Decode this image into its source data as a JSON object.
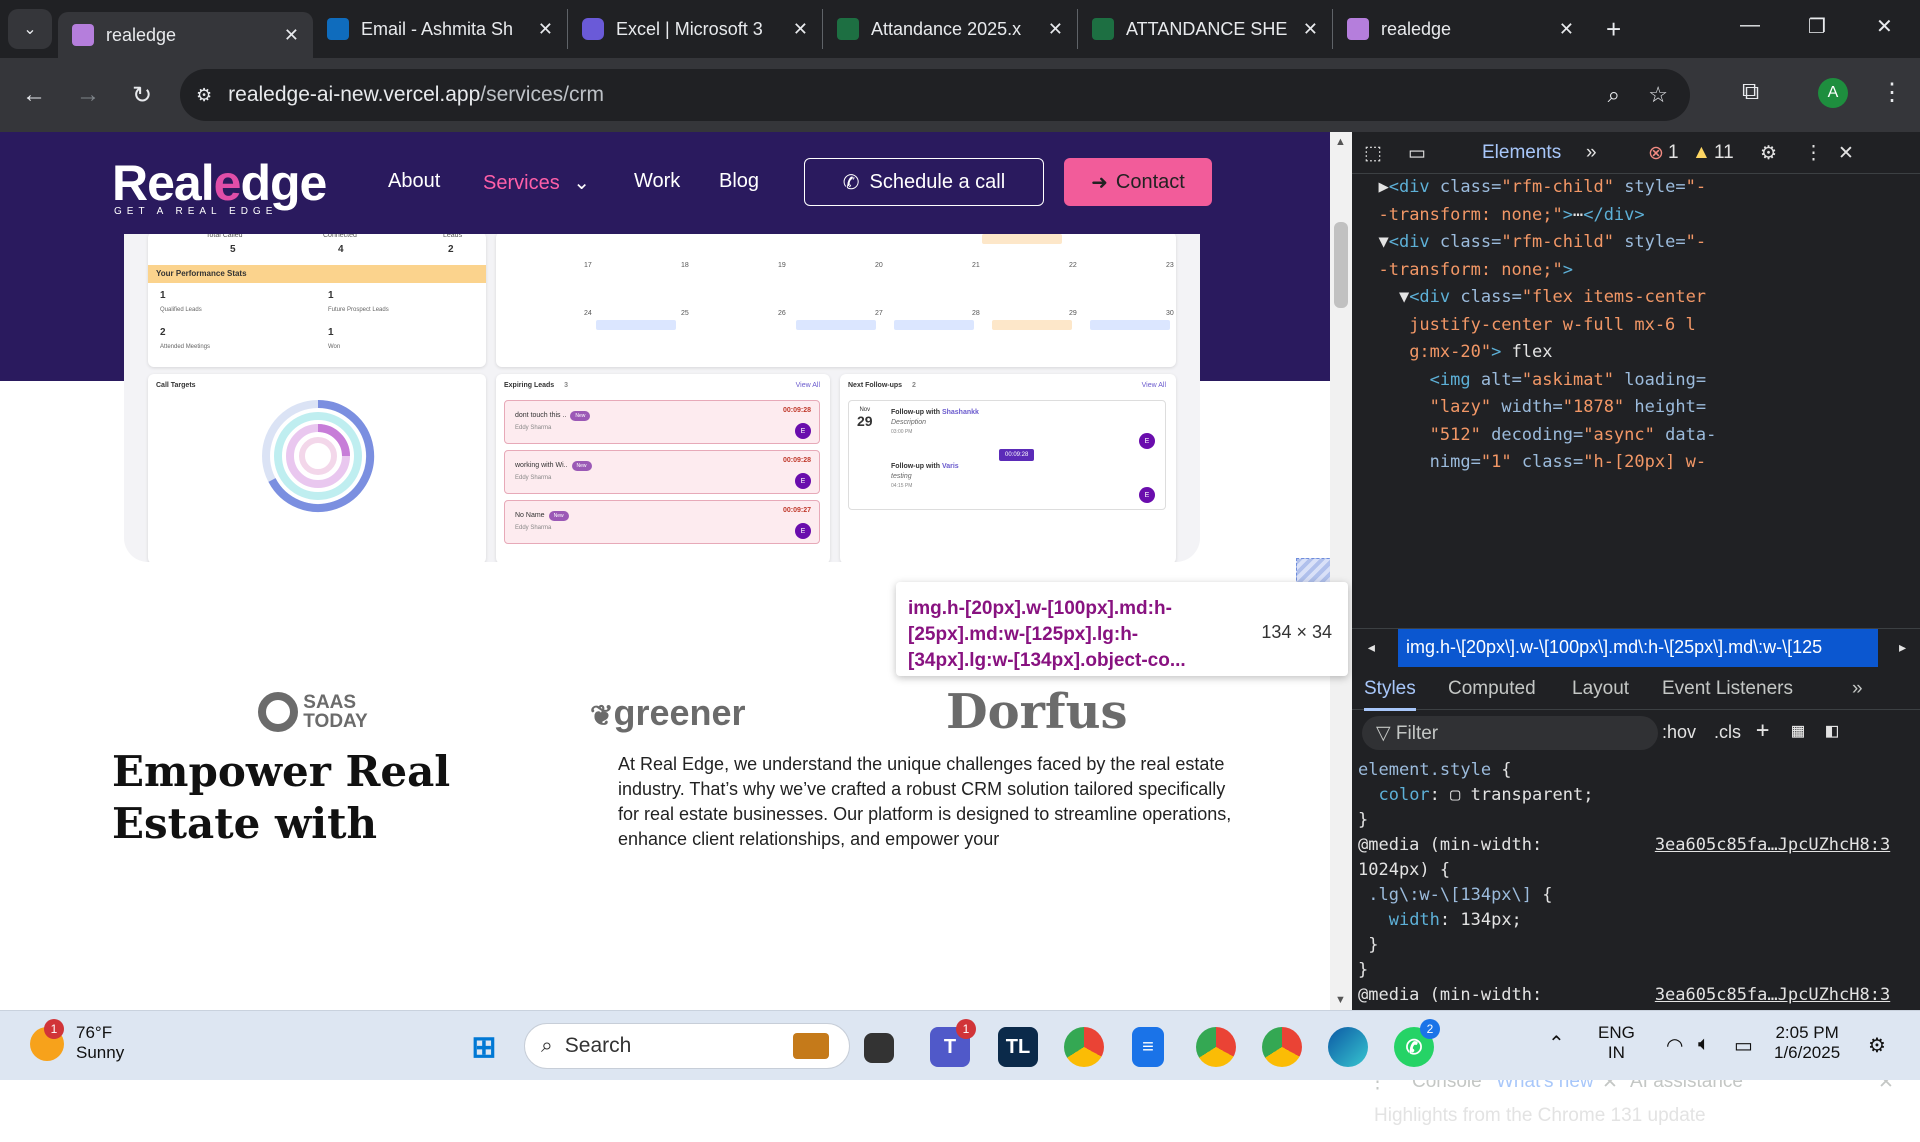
{
  "browser": {
    "tabs": [
      {
        "title": "realedge",
        "active": true,
        "icon": "realedge-favicon"
      },
      {
        "title": "Email - Ashmita Sh",
        "icon": "outlook-icon"
      },
      {
        "title": "Excel | Microsoft 3",
        "icon": "copilot-icon"
      },
      {
        "title": "Attandance 2025.x",
        "icon": "excel-icon"
      },
      {
        "title": "ATTANDANCE SHE",
        "icon": "excel-icon"
      },
      {
        "title": "realedge",
        "icon": "realedge-favicon"
      }
    ],
    "url_host": "realedge-ai-new.vercel.app",
    "url_path": "/services/crm",
    "profile_initial": "A"
  },
  "site": {
    "logo": "Realedge",
    "logo_tagline": "GET A REAL EDGE",
    "nav": [
      "About",
      "Services",
      "Work",
      "Blog"
    ],
    "schedule_label": "Schedule a call",
    "contact_label": "Contact",
    "dashboard": {
      "summary_labels": [
        "Total Called",
        "Connected",
        "Leads"
      ],
      "summary_values": [
        "5",
        "4",
        "2"
      ],
      "perf_title": "Your Performance Stats",
      "stats": [
        {
          "value": "1",
          "label": "Qualified Leads"
        },
        {
          "value": "1",
          "label": "Future Prospect Leads"
        },
        {
          "value": "2",
          "label": "Attended Meetings"
        },
        {
          "value": "1",
          "label": "Won"
        }
      ],
      "call_targets": "Call Targets",
      "calendar_days_row1": [
        "17",
        "18",
        "19",
        "20",
        "21",
        "22",
        "23"
      ],
      "calendar_days_row2": [
        "24",
        "25",
        "26",
        "27",
        "28",
        "29",
        "30"
      ],
      "expiring_title": "Expiring Leads",
      "expiring_count": "3",
      "view_all": "View All",
      "leads": [
        {
          "name": "dont touch this ..",
          "who": "Eddy Sharma",
          "timer": "00:09:28",
          "badge": "New"
        },
        {
          "name": "working with Wi..",
          "who": "Eddy Sharma",
          "timer": "00:09:28",
          "badge": "New"
        },
        {
          "name": "No Name",
          "who": "Eddy Sharma",
          "timer": "00:09:27",
          "badge": "New"
        }
      ],
      "followups_title": "Next Follow-ups",
      "followups_count": "2",
      "fu_month": "Nov",
      "fu_day": "29",
      "followups": [
        {
          "title": "Follow-up with",
          "name": "Shashankk",
          "desc": "Description",
          "time": "03:00 PM"
        },
        {
          "title": "Follow-up with",
          "name": "Varis",
          "desc": "testing",
          "time": "04:15 PM"
        }
      ],
      "fu_timer": "00:09:28"
    },
    "partners": [
      "SAAS TODAY",
      "greener",
      "Dorfus"
    ],
    "headline": "Empower Real Estate with",
    "paragraph": "At Real Edge, we understand the unique challenges faced by the real estate industry. That’s why we’ve crafted a robust CRM solution tailored specifically for real estate businesses. Our platform is designed to streamline operations, enhance client relationships, and empower your"
  },
  "inspector": {
    "selector": "img.h-[20px].w-[100px].md:h-[25px].md:w-[125px].lg:h-[34px].lg:w-[134px].object-co...",
    "size": "134 × 34"
  },
  "devtools": {
    "tab": "Elements",
    "errors": "1",
    "warnings": "11",
    "breadcrumb": "img.h-\\[20px\\].w-\\[100px\\].md\\:h-\\[25px\\].md\\:w-\\[125",
    "subtabs": [
      "Styles",
      "Computed",
      "Layout",
      "Event Listeners"
    ],
    "filter_placeholder": "Filter",
    "hov": ":hov",
    "cls": ".cls",
    "drawer_tabs": [
      "Console",
      "What's new",
      "AI assistance"
    ],
    "drawer_message": "Highlights from the Chrome 131 update",
    "source1": "3ea605c85fa…JpcUZhcH8:3",
    "source2": "3ea605c85fa…JpcUZhcH8:3"
  },
  "taskbar": {
    "weather_temp": "76°F",
    "weather_desc": "Sunny",
    "search": "Search",
    "lang": "ENG",
    "region": "IN",
    "time": "2:05 PM",
    "date": "1/6/2025",
    "badge_weather": "1",
    "badge_teams": "1",
    "badge_whatsapp": "2"
  }
}
